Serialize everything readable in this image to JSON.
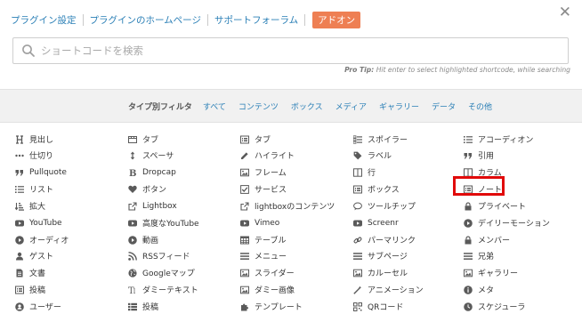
{
  "topnav": {
    "items": [
      "プラグイン設定",
      "プラグインのホームページ",
      "サポートフォーラム"
    ],
    "addon": "アドオン"
  },
  "search": {
    "placeholder": "ショートコードを検索"
  },
  "protip": {
    "lead": "Pro Tip:",
    "text": "Hit enter to select highlighted shortcode, while searching"
  },
  "filters": {
    "label": "タイプ別フィルタ",
    "items": [
      "すべて",
      "コンテンツ",
      "ボックス",
      "メディア",
      "ギャラリー",
      "データ",
      "その他"
    ]
  },
  "shortcodes": {
    "columns": [
      [
        {
          "label": "見出し",
          "icon": "heading-icon"
        },
        {
          "label": "仕切り",
          "icon": "ellipsis-icon"
        },
        {
          "label": "Pullquote",
          "icon": "quote-icon"
        },
        {
          "label": "リスト",
          "icon": "list-icon"
        },
        {
          "label": "拡大",
          "icon": "sort-amount-icon"
        },
        {
          "label": "YouTube",
          "icon": "youtube-play-icon"
        },
        {
          "label": "オーディオ",
          "icon": "play-circle-icon"
        },
        {
          "label": "ゲスト",
          "icon": "user-icon"
        },
        {
          "label": "文書",
          "icon": "file-text-icon"
        },
        {
          "label": "投稿",
          "icon": "list-alt-icon"
        },
        {
          "label": "ユーザー",
          "icon": "user-circle-icon"
        }
      ],
      [
        {
          "label": "タブ",
          "icon": "tabs-icon"
        },
        {
          "label": "スペーサ",
          "icon": "arrows-vertical-icon"
        },
        {
          "label": "Dropcap",
          "icon": "bold-icon"
        },
        {
          "label": "ボタン",
          "icon": "heart-icon"
        },
        {
          "label": "Lightbox",
          "icon": "external-link-icon"
        },
        {
          "label": "高度なYouTube",
          "icon": "youtube-play-icon"
        },
        {
          "label": "動画",
          "icon": "play-circle-icon"
        },
        {
          "label": "RSSフィード",
          "icon": "rss-icon"
        },
        {
          "label": "Googleマップ",
          "icon": "globe-icon"
        },
        {
          "label": "ダミーテキスト",
          "icon": "text-height-icon"
        },
        {
          "label": "投稿",
          "icon": "th-list-icon"
        }
      ],
      [
        {
          "label": "タブ",
          "icon": "list-alt-icon"
        },
        {
          "label": "ハイライト",
          "icon": "pencil-icon"
        },
        {
          "label": "フレーム",
          "icon": "picture-icon"
        },
        {
          "label": "サービス",
          "icon": "check-square-icon"
        },
        {
          "label": "lightboxのコンテンツ",
          "icon": "external-link-icon"
        },
        {
          "label": "Vimeo",
          "icon": "youtube-play-icon"
        },
        {
          "label": "テーブル",
          "icon": "table-icon"
        },
        {
          "label": "メニュー",
          "icon": "bars-icon"
        },
        {
          "label": "スライダー",
          "icon": "picture-icon"
        },
        {
          "label": "ダミー画像",
          "icon": "picture-icon"
        },
        {
          "label": "テンプレート",
          "icon": "puzzle-icon"
        }
      ],
      [
        {
          "label": "スポイラー",
          "icon": "list-ul-icon"
        },
        {
          "label": "ラベル",
          "icon": "tag-icon"
        },
        {
          "label": "行",
          "icon": "columns-icon"
        },
        {
          "label": "ボックス",
          "icon": "list-alt-icon"
        },
        {
          "label": "ツールチップ",
          "icon": "comment-icon"
        },
        {
          "label": "Screenr",
          "icon": "youtube-play-icon"
        },
        {
          "label": "パーマリンク",
          "icon": "link-icon"
        },
        {
          "label": "サブページ",
          "icon": "bars-icon"
        },
        {
          "label": "カルーセル",
          "icon": "picture-icon"
        },
        {
          "label": "アニメーション",
          "icon": "magic-icon"
        },
        {
          "label": "QRコード",
          "icon": "qrcode-icon"
        }
      ],
      [
        {
          "label": "アコーディオン",
          "icon": "list-icon"
        },
        {
          "label": "引用",
          "icon": "quote-icon"
        },
        {
          "label": "カラム",
          "icon": "columns-icon"
        },
        {
          "label": "ノート",
          "icon": "list-alt-icon"
        },
        {
          "label": "プライベート",
          "icon": "lock-icon"
        },
        {
          "label": "デイリーモーション",
          "icon": "play-circle-icon"
        },
        {
          "label": "メンバー",
          "icon": "lock-icon"
        },
        {
          "label": "兄弟",
          "icon": "bars-icon"
        },
        {
          "label": "ギャラリー",
          "icon": "picture-icon"
        },
        {
          "label": "メタ",
          "icon": "info-circle-icon"
        },
        {
          "label": "スケジューラ",
          "icon": "clock-icon"
        }
      ]
    ],
    "highlighted": "ノート"
  }
}
